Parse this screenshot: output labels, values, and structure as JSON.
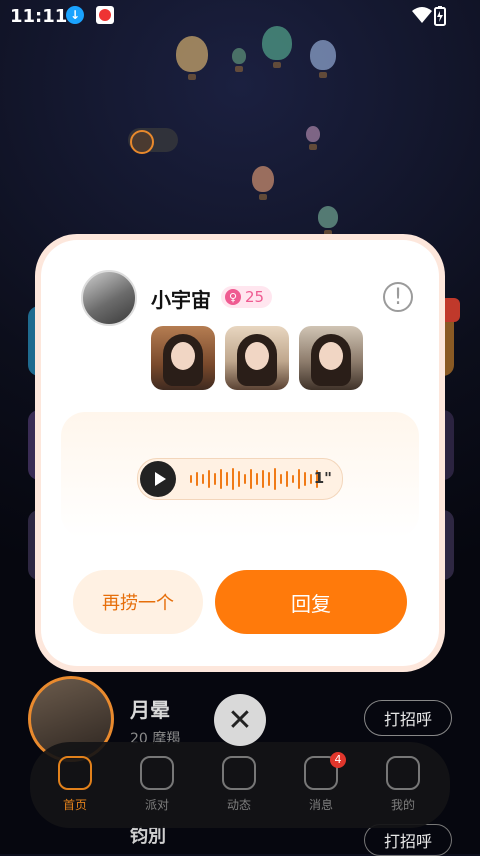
{
  "status_bar": {
    "time": "11:11"
  },
  "profile": {
    "name": "小宇宙",
    "age": "25",
    "photos": [
      "photo-1",
      "photo-2",
      "photo-3"
    ]
  },
  "voice": {
    "duration": "1\""
  },
  "buttons": {
    "again": "再捞一个",
    "reply": "回复"
  },
  "list": [
    {
      "name": "月晕",
      "sub": "20 摩羯",
      "greet": "打招呼"
    },
    {
      "name": "钧別",
      "greet": "打招呼"
    }
  ],
  "tabs": [
    {
      "label": "首页",
      "active": true
    },
    {
      "label": "派对"
    },
    {
      "label": "动态"
    },
    {
      "label": "消息",
      "badge": "4"
    },
    {
      "label": "我的"
    }
  ],
  "colors": {
    "accent": "#ff7a0b",
    "age_badge": "#ef5b91"
  }
}
